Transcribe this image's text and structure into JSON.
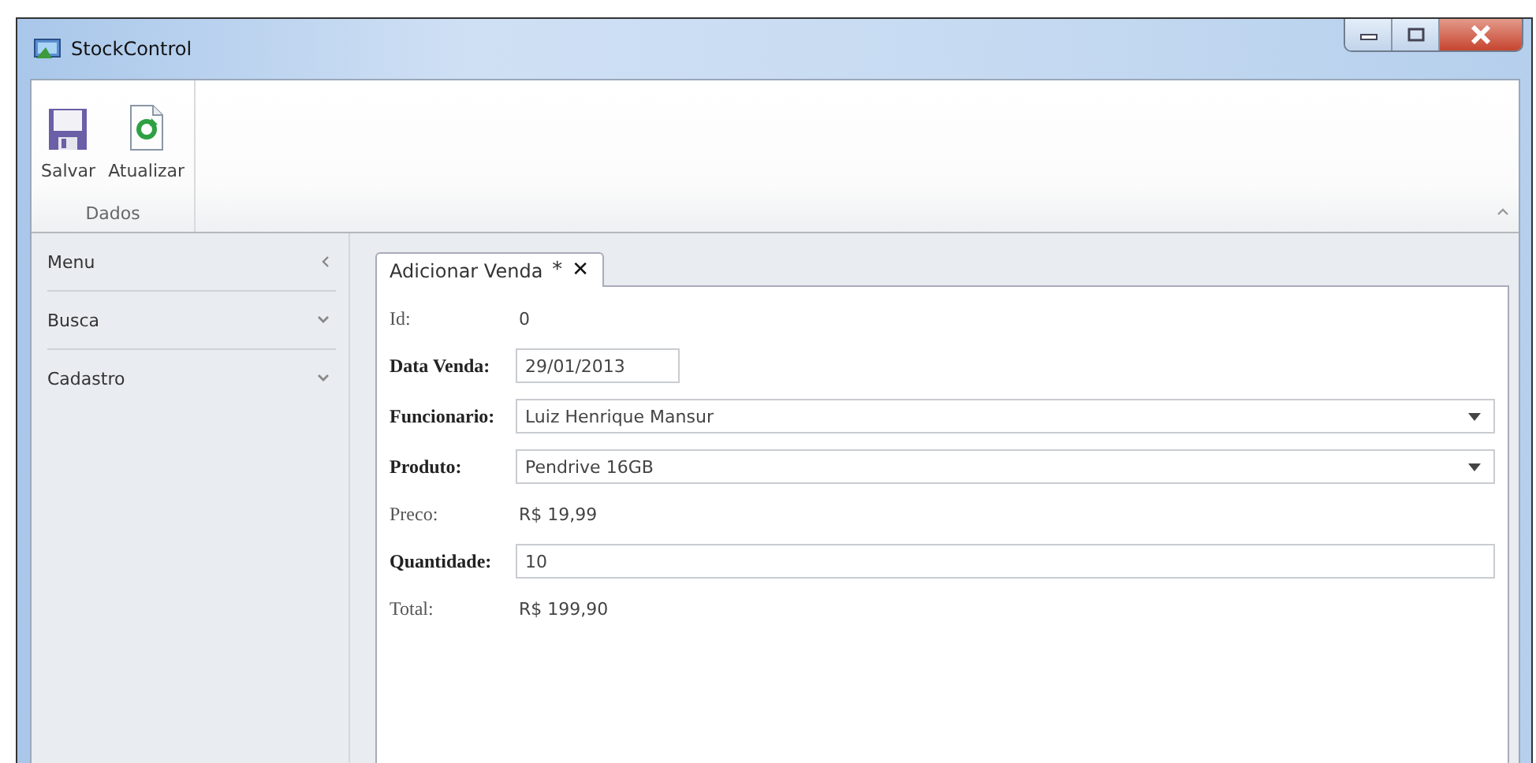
{
  "window": {
    "title": "StockControl"
  },
  "ribbon": {
    "groups": [
      {
        "label": "Dados",
        "buttons": [
          {
            "label": "Salvar",
            "kind": "save"
          },
          {
            "label": "Atualizar",
            "kind": "refresh"
          }
        ]
      }
    ]
  },
  "sidebar": {
    "title": "Menu",
    "items": [
      {
        "label": "Busca",
        "expanded": false
      },
      {
        "label": "Cadastro",
        "expanded": false
      }
    ]
  },
  "tabs": [
    {
      "label": "Adicionar Venda",
      "modified_mark": "*",
      "close": "✕",
      "selected": true
    }
  ],
  "form": {
    "fields": [
      {
        "label": "Id:",
        "value": "0",
        "kind": "text"
      },
      {
        "label": "Data Venda:",
        "value": "29/01/2013",
        "kind": "date"
      },
      {
        "label": "Funcionario:",
        "value": "Luiz Henrique Mansur",
        "kind": "dropdown"
      },
      {
        "label": "Produto:",
        "value": "Pendrive 16GB",
        "kind": "dropdown"
      },
      {
        "label": "Preco:",
        "value": "R$ 19,99",
        "kind": "text"
      },
      {
        "label": "Quantidade:",
        "value": "10",
        "kind": "input"
      },
      {
        "label": "Total:",
        "value": "R$ 199,90",
        "kind": "text"
      }
    ]
  }
}
